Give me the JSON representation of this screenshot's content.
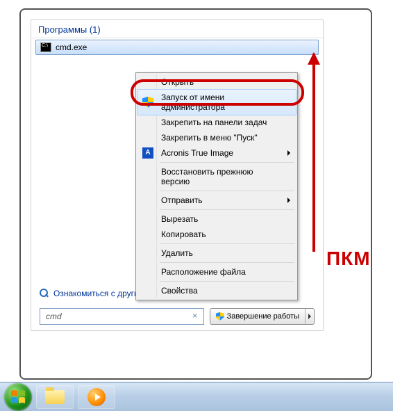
{
  "section_header": "Программы (1)",
  "result": {
    "name": "cmd.exe"
  },
  "context_menu": {
    "open": "Открыть",
    "run_as_admin": "Запуск от имени администратора",
    "pin_taskbar": "Закрепить на панели задач",
    "pin_start": "Закрепить в меню \"Пуск\"",
    "acronis": "Acronis True Image",
    "restore": "Восстановить прежнюю версию",
    "send_to": "Отправить",
    "cut": "Вырезать",
    "copy": "Копировать",
    "delete": "Удалить",
    "open_location": "Расположение файла",
    "properties": "Свойства"
  },
  "see_more": "Ознакомиться с другими результатами",
  "search": {
    "value": "cmd"
  },
  "shutdown": {
    "label": "Завершение работы"
  },
  "annotation": {
    "label": "ПКМ"
  }
}
